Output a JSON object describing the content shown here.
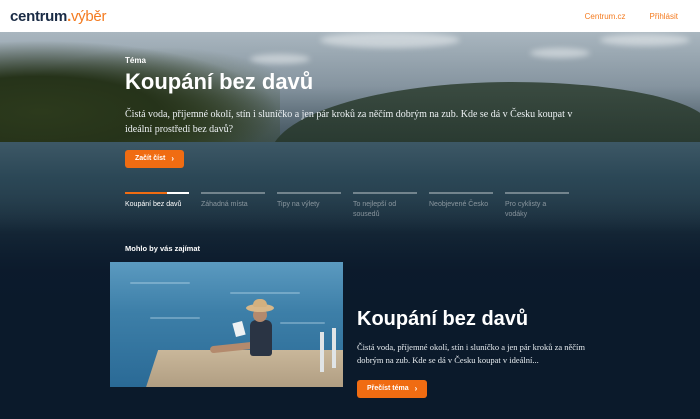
{
  "header": {
    "logo_main": "centrum",
    "logo_dot": ".",
    "logo_sub": "výběr",
    "nav": [
      {
        "label": "Centrum.cz"
      },
      {
        "label": "Přihlásit"
      }
    ]
  },
  "hero": {
    "eyebrow": "Téma",
    "title": "Koupání bez davů",
    "description": "Čistá voda, příjemné okolí, stín i sluníčko a jen pár kroků za něčím dobrým na zub. Kde se dá v Česku koupat v ideální prostředí bez davů?",
    "button_label": "Začít číst",
    "button_icon": "chevron-right-icon"
  },
  "tabs": [
    {
      "label": "Koupání bez davů",
      "active": true
    },
    {
      "label": "Záhadná místa",
      "active": false
    },
    {
      "label": "Tipy na výlety",
      "active": false
    },
    {
      "label": "To nejlepší od sousedů",
      "active": false
    },
    {
      "label": "Neobjevené Česko",
      "active": false
    },
    {
      "label": "Pro cyklisty a vodáky",
      "active": false
    }
  ],
  "suggestions": {
    "heading": "Mohlo by vás zajímat",
    "card": {
      "title": "Koupání bez davů",
      "description": "Čistá voda, příjemné okolí, stín i sluníčko a jen pár kroků za něčím dobrým na zub. Kde se dá v Česku koupat v ideální...",
      "button_label": "Přečíst téma",
      "button_icon": "chevron-right-icon"
    }
  },
  "colors": {
    "accent": "#f06c12",
    "background": "#0b1a2b"
  }
}
